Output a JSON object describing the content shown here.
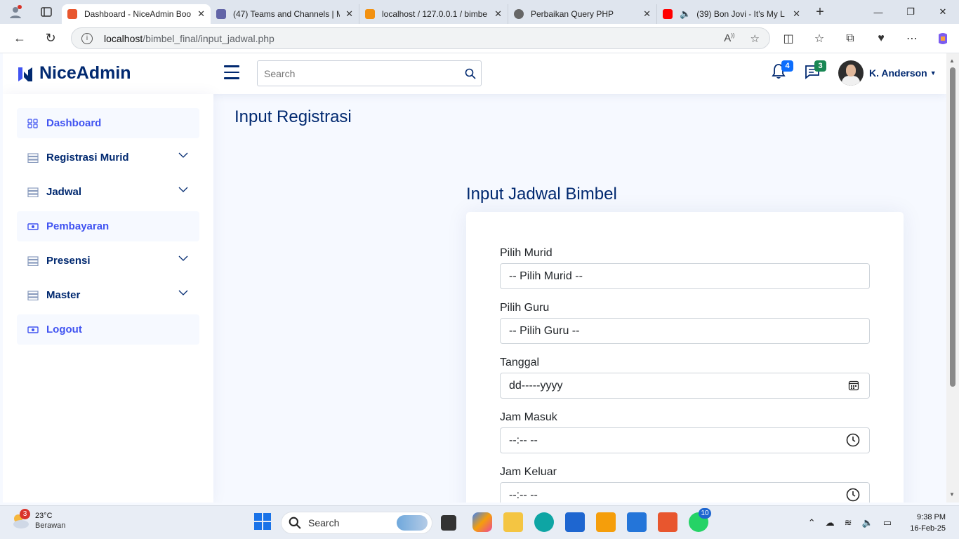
{
  "browser": {
    "tabs": [
      {
        "title": "Dashboard - NiceAdmin Boo",
        "active": true,
        "favicon_color": "#e8562e"
      },
      {
        "title": "(47) Teams and Channels | M",
        "active": false,
        "favicon_color": "#6264a7"
      },
      {
        "title": "localhost / 127.0.0.1 / bimbe",
        "active": false,
        "favicon_color": "#f29111"
      },
      {
        "title": "Perbaikan Query PHP",
        "active": false,
        "favicon_color": "#666666"
      },
      {
        "title": "(39) Bon Jovi - It's My L",
        "active": false,
        "favicon_color": "#ff0000"
      }
    ],
    "url_host": "localhost",
    "url_path": "/bimbel_final/input_jadwal.php"
  },
  "header": {
    "logo_text": "NiceAdmin",
    "search_placeholder": "Search",
    "notifications_count": "4",
    "messages_count": "3",
    "profile_name": "K. Anderson"
  },
  "sidebar": {
    "items": [
      {
        "label": "Dashboard",
        "icon": "grid-icon",
        "expandable": false,
        "highlight": true
      },
      {
        "label": "Registrasi Murid",
        "icon": "list-icon",
        "expandable": true,
        "highlight": false
      },
      {
        "label": "Jadwal",
        "icon": "list-icon",
        "expandable": true,
        "highlight": false
      },
      {
        "label": "Pembayaran",
        "icon": "cash-icon",
        "expandable": false,
        "highlight": true
      },
      {
        "label": "Presensi",
        "icon": "list-icon",
        "expandable": true,
        "highlight": false
      },
      {
        "label": "Master",
        "icon": "list-icon",
        "expandable": true,
        "highlight": false
      },
      {
        "label": "Logout",
        "icon": "cash-icon",
        "expandable": false,
        "highlight": true
      }
    ]
  },
  "main": {
    "page_title": "Input Registrasi",
    "card_title": "Input Jadwal Bimbel",
    "form": {
      "murid_label": "Pilih Murid",
      "murid_value": "-- Pilih Murid --",
      "guru_label": "Pilih Guru",
      "guru_value": "-- Pilih Guru --",
      "tanggal_label": "Tanggal",
      "tanggal_value": "dd-----yyyy",
      "jam_masuk_label": "Jam Masuk",
      "jam_masuk_value": "--:-- --",
      "jam_keluar_label": "Jam Keluar",
      "jam_keluar_value": "--:-- --"
    }
  },
  "taskbar": {
    "weather_badge": "3",
    "temperature": "23°C",
    "condition": "Berawan",
    "search_label": "Search",
    "whatsapp_badge": "10",
    "time": "9:38 PM",
    "date": "16-Feb-25"
  },
  "colors": {
    "brand_navy": "#012970",
    "brand_blue": "#4154f1",
    "notif_badge": "#0d6efd",
    "msg_badge": "#198754"
  }
}
